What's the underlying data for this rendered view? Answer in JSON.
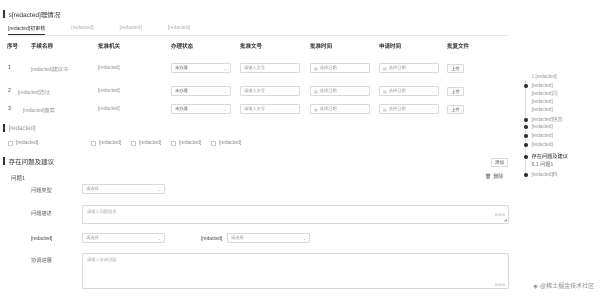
{
  "section1": {
    "title": "s[redacted]理情况"
  },
  "tabs": [
    {
      "label": "[redacted]初审核",
      "active": true
    },
    {
      "label": "[redacted]",
      "active": false
    },
    {
      "label": "[redacted]",
      "active": false
    },
    {
      "label": "[redacted]",
      "active": false
    }
  ],
  "table": {
    "headers": [
      "序号",
      "手续名称",
      "批准机关",
      "办理状态",
      "批准文号",
      "批准时间",
      "申请时间",
      "批复文件"
    ],
    "rows": [
      {
        "index": "1",
        "name": "[redacted]建议书",
        "authority": "[redacted]",
        "status": "未办理",
        "doc_placeholder": "请输入文号",
        "approval_placeholder": "选择日期",
        "apply_placeholder": "选择日期",
        "upload": "上传"
      },
      {
        "index": "2",
        "name": "[redacted]选址",
        "authority": "[redacted]",
        "status": "未办理",
        "doc_placeholder": "请输入文号",
        "approval_placeholder": "选择日期",
        "apply_placeholder": "选择日期",
        "upload": "上传"
      },
      {
        "index": "3",
        "name": "[redacted]备案",
        "authority": "[redacted]",
        "status": "未办理",
        "doc_placeholder": "请输入文号",
        "approval_placeholder": "选择日期",
        "apply_placeholder": "选择日期",
        "upload": "上传"
      }
    ]
  },
  "section2": {
    "title": "[redacted]",
    "checkboxes": [
      "[redacted]",
      "[redacted]",
      "[redacted]",
      "[redacted]",
      "[redacted]"
    ]
  },
  "section3": {
    "title": "存在问题及建议",
    "add_label": "添加",
    "issue_label": "问题1",
    "delete_label": "删除",
    "fields": {
      "issue_type": {
        "label": "问题类型",
        "placeholder": "请选择"
      },
      "issue_desc": {
        "label": "问题描述",
        "placeholder": "请输入问题描述",
        "counter": "0/500"
      },
      "left_select": {
        "label": "[redacted]",
        "placeholder": "请选择"
      },
      "right_select": {
        "label": "[redacted]",
        "placeholder": "请选择"
      },
      "coordination": {
        "label": "协调进展",
        "placeholder": "请输入协调进展",
        "counter": "0/500"
      }
    }
  },
  "anchor_nav": [
    {
      "label": "1 [redacted]",
      "dot": false,
      "sub": false
    },
    {
      "label": "[redacted]",
      "dot": true,
      "sub": false
    },
    {
      "label": "[redacted]况",
      "dot": false,
      "sub": true
    },
    {
      "label": "[redacted]",
      "dot": false,
      "sub": true
    },
    {
      "label": "[redacted]",
      "dot": false,
      "sub": true
    },
    {
      "label": "[redacted]信息",
      "dot": true,
      "sub": false
    },
    {
      "label": "[redacted]",
      "dot": true,
      "sub": false
    },
    {
      "label": "[redacted]",
      "dot": true,
      "sub": false
    },
    {
      "label": "[redacted]",
      "dot": true,
      "sub": false
    },
    {
      "label": "存在问题及建议",
      "dot": true,
      "sub": false,
      "active": true
    },
    {
      "label": "6.1 问题1",
      "dot": false,
      "sub": true
    },
    {
      "label": "[redacted]料",
      "dot": true,
      "sub": false
    }
  ],
  "watermark": {
    "text": "@稀土掘金技术社区"
  }
}
